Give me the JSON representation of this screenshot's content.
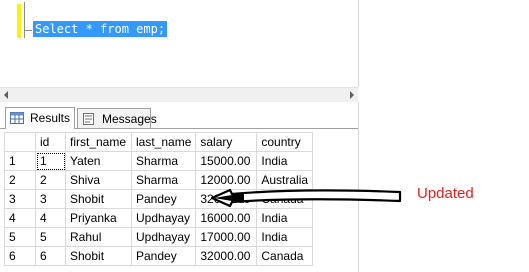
{
  "editor": {
    "query": "Select * from emp;"
  },
  "results_pane": {
    "tabs": [
      {
        "label": "Results",
        "icon": "grid-icon"
      },
      {
        "label": "Messages",
        "icon": "message-icon"
      }
    ],
    "columns": [
      "id",
      "first_name",
      "last_name",
      "salary",
      "country"
    ],
    "rows": [
      {
        "rownum": "1",
        "id": "1",
        "first_name": "Yaten",
        "last_name": "Sharma",
        "salary": "15000.00",
        "country": "India"
      },
      {
        "rownum": "2",
        "id": "2",
        "first_name": "Shiva",
        "last_name": "Sharma",
        "salary": "12000.00",
        "country": "Australia"
      },
      {
        "rownum": "3",
        "id": "3",
        "first_name": "Shobit",
        "last_name": "Pandey",
        "salary": "32000.00",
        "country": "Canada"
      },
      {
        "rownum": "4",
        "id": "4",
        "first_name": "Priyanka",
        "last_name": "Updhayay",
        "salary": "16000.00",
        "country": "India"
      },
      {
        "rownum": "5",
        "id": "5",
        "first_name": "Rahul",
        "last_name": "Updhayay",
        "salary": "17000.00",
        "country": "India"
      },
      {
        "rownum": "6",
        "id": "6",
        "first_name": "Shobit",
        "last_name": "Pandey",
        "salary": "32000.00",
        "country": "Canada"
      }
    ]
  },
  "annotation": {
    "text": "Updated",
    "color": "#e11f1f"
  },
  "colors": {
    "selection": "#3399ff",
    "breakpoint_margin": "#fff200"
  }
}
